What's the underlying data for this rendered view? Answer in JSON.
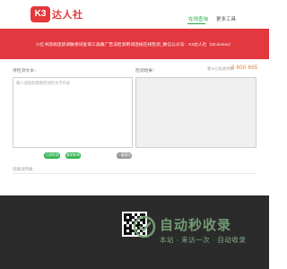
{
  "header": {
    "logo_mark": "K3",
    "logo_text": "达人社",
    "nav": [
      {
        "label": "在线查询",
        "active": true
      },
      {
        "label": "更多工具",
        "active": false
      }
    ]
  },
  "banner": {
    "text": "小红书违规违禁词敏感词查询工具跟广告法检测用词违规在线检测_微信公众号：K3达人社（ID:doinex）"
  },
  "input": {
    "label": "待检测文本：",
    "placeholder": "输入或粘贴需要检测的文字内容"
  },
  "output": {
    "label": "检测结果：",
    "counter_label": "累计已检测字数",
    "counter_value": "3 600 695"
  },
  "buttons": {
    "detect": "立即检测",
    "copy": "复制结果",
    "clear": "一键清空"
  },
  "hint": "违规词列表：",
  "watermark": {
    "title": "自动秒收录",
    "subtitle": "本站 · 来访一次 · 自动收录"
  },
  "colors": {
    "brand_red": "#e3383f",
    "accent_green": "#2fb24f",
    "counter_orange": "#e8792f"
  }
}
